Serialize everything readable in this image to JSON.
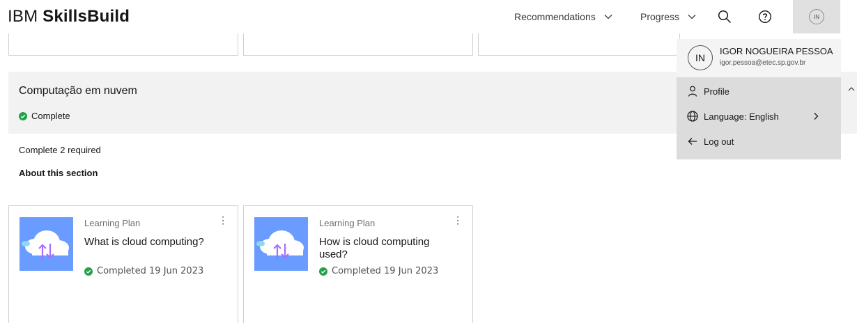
{
  "header": {
    "brand_prefix": "IBM",
    "brand_name": "SkillsBuild",
    "nav": [
      {
        "label": "Recommendations"
      },
      {
        "label": "Progress"
      }
    ],
    "avatar_initials": "IN"
  },
  "section": {
    "title": "Computação em nuvem",
    "status": "Complete",
    "requirement": "Complete 2 required",
    "about_link": "About this section"
  },
  "cards": [
    {
      "type": "Learning Plan",
      "title": "What is cloud computing?",
      "status": "Completed 19 Jun 2023"
    },
    {
      "type": "Learning Plan",
      "title": "How is cloud computing used?",
      "status": "Completed 19 Jun 2023"
    }
  ],
  "user_menu": {
    "initials": "IN",
    "name": "IGOR NOGUEIRA PESSOA",
    "email": "igor.pessoa@etec.sp.gov.br",
    "items": [
      {
        "label": "Profile",
        "icon": "user-icon"
      },
      {
        "label": "Language: English",
        "icon": "globe-icon"
      },
      {
        "label": "Log out",
        "icon": "arrow-left-icon"
      }
    ]
  },
  "colors": {
    "complete_green": "#24a148",
    "thumb_blue": "#6a9cff",
    "band_gray": "#f2f2f2",
    "menu_gray": "#dcdcdc"
  }
}
